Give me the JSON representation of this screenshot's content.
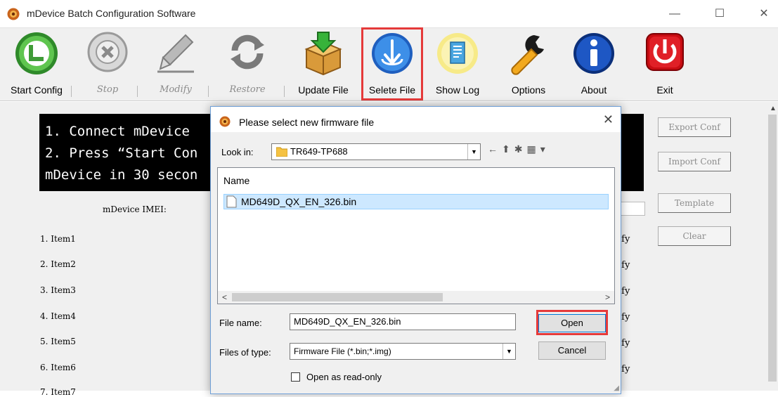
{
  "window": {
    "title": "mDevice Batch Configuration Software",
    "controls": {
      "minimize": "—",
      "maximize": "☐",
      "close": "✕"
    }
  },
  "toolbar": {
    "buttons": [
      {
        "label": "Start Config",
        "enabled": true,
        "icon": "start-icon"
      },
      {
        "label": "Stop",
        "enabled": false,
        "icon": "stop-icon"
      },
      {
        "label": "Modify",
        "enabled": false,
        "icon": "pencil-icon"
      },
      {
        "label": "Restore",
        "enabled": false,
        "icon": "restore-icon"
      },
      {
        "label": "Update File",
        "enabled": true,
        "icon": "package-icon"
      },
      {
        "label": "Selete File",
        "enabled": true,
        "icon": "select-file-icon"
      },
      {
        "label": "Show Log",
        "enabled": true,
        "icon": "log-icon"
      },
      {
        "label": "Options",
        "enabled": true,
        "icon": "wrench-icon"
      },
      {
        "label": "About",
        "enabled": true,
        "icon": "info-icon"
      },
      {
        "label": "Exit",
        "enabled": true,
        "icon": "exit-icon"
      }
    ]
  },
  "main": {
    "instructions": [
      "1. Connect mDevice",
      "2. Press “Start Con",
      "mDevice in 30 secon"
    ],
    "imei_label": "mDevice IMEI:",
    "items": [
      "1. Item1",
      "2. Item2",
      "3. Item3",
      "4. Item4",
      "5. Item5",
      "6. Item6",
      "7. Item7"
    ],
    "modify_fragment": "ify",
    "side_buttons": [
      "Export Conf",
      "Import Conf",
      "Template",
      "Clear"
    ]
  },
  "dialog": {
    "title": "Please select new firmware file",
    "look_in_label": "Look in:",
    "look_in_value": "TR649-TP688",
    "column_name": "Name",
    "files": [
      "MD649D_QX_EN_326.bin"
    ],
    "file_name_label": "File name:",
    "file_name_value": "MD649D_QX_EN_326.bin",
    "files_of_type_label": "Files of type:",
    "files_of_type_value": "Firmware File (*.bin;*.img)",
    "open_label": "Open",
    "cancel_label": "Cancel",
    "read_only_label": "Open as read-only"
  },
  "colors": {
    "highlight": "#e53a3a",
    "selection": "#cde8ff",
    "dialog_border": "#6fa0d8"
  }
}
